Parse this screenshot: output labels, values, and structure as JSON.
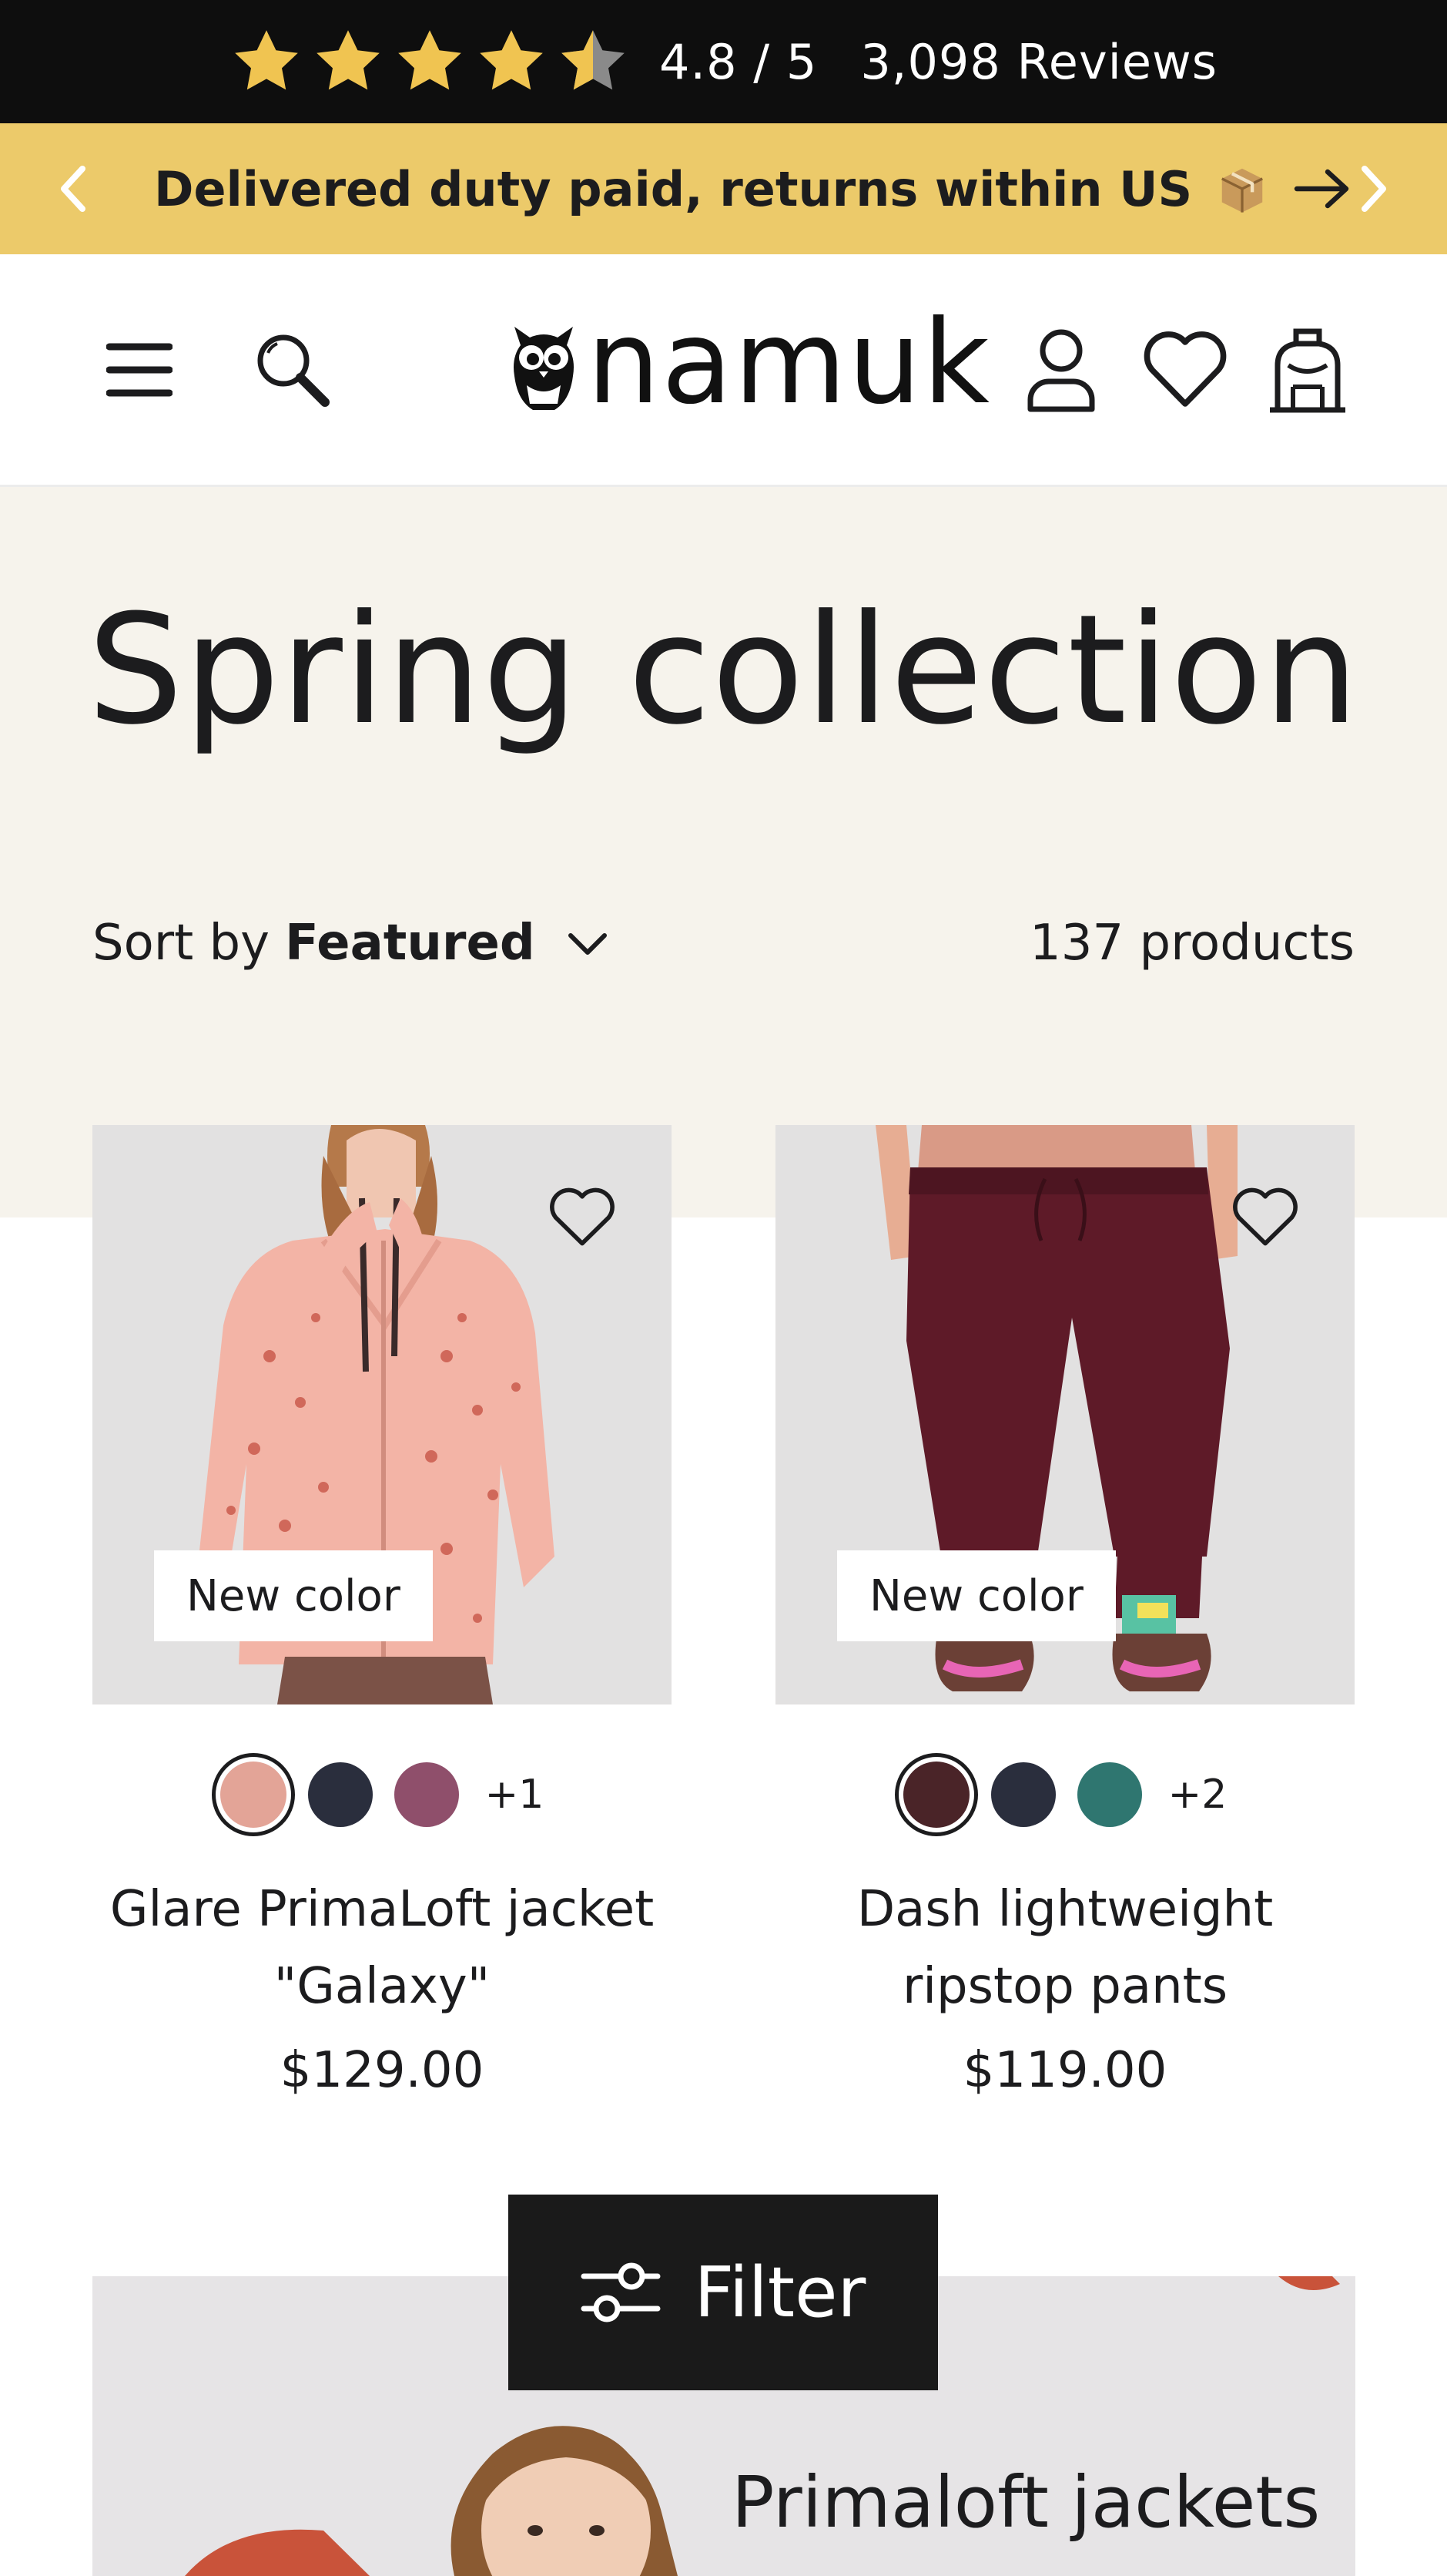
{
  "review_bar": {
    "rating_text": "4.8 / 5",
    "reviews_text": "3,098 Reviews",
    "rating_value": 4.8,
    "star_color": "#f0c451",
    "icons": [
      "star-icon",
      "star-icon",
      "star-icon",
      "star-icon",
      "half-star-icon"
    ]
  },
  "announcement": {
    "text": "Delivered duty paid, returns within US",
    "emoji_icon": "package-icon",
    "arrow_icon": "arrow-right-icon",
    "prev_icon": "chevron-left-icon",
    "next_icon": "chevron-right-icon",
    "background": "#ecca6a"
  },
  "header": {
    "logo_text": "namuk",
    "logo_icon": "owl-icon",
    "icons": [
      "menu-icon",
      "search-icon",
      "account-icon",
      "heart-icon",
      "bag-icon"
    ]
  },
  "collection": {
    "title": "Spring collection",
    "sort_label": "Sort by",
    "sort_value": "Featured",
    "product_count": "137 products",
    "background": "#f6f3ec"
  },
  "products": [
    {
      "badge": "New color",
      "title_line1": "Glare PrimaLoft jacket",
      "title_line2": "\"Galaxy\"",
      "price": "$129.00",
      "swatches": [
        "#e3a497",
        "#2a2e3d",
        "#8f4f6b"
      ],
      "selected_swatch": 0,
      "more_colors": "+1"
    },
    {
      "badge": "New color",
      "title_line1": "Dash lightweight",
      "title_line2": "ripstop pants",
      "price": "$119.00",
      "swatches": [
        "#4a2428",
        "#2a2e3d",
        "#2f7670"
      ],
      "selected_swatch": 0,
      "more_colors": "+2"
    }
  ],
  "promo": {
    "title": "Primaloft jackets"
  },
  "filter_button": {
    "label": "Filter",
    "icon": "sliders-icon"
  }
}
